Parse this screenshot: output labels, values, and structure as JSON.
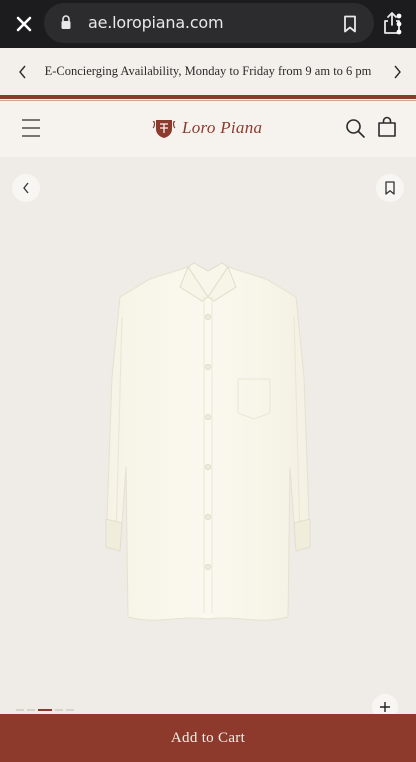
{
  "browser": {
    "url": "ae.loropiana.com"
  },
  "announcement": {
    "text": "E-Concierging Availability, Monday to Friday from 9 am to 6 pm"
  },
  "header": {
    "logo_text": "Loro Piana"
  },
  "product": {
    "gallery_count": 5,
    "gallery_active_index": 2
  },
  "cart": {
    "button_label": "Add to Cart"
  },
  "colors": {
    "brand": "#8d3a2c",
    "background": "#efebe6",
    "browser_chrome": "#1c1c1e"
  },
  "icons": [
    "close-icon",
    "lock-icon",
    "bookmark-icon",
    "share-icon",
    "more-icon",
    "chevron-left-icon",
    "chevron-right-icon",
    "menu-icon",
    "search-icon",
    "shopping-bag-icon",
    "wishlist-bookmark-icon",
    "plus-icon"
  ]
}
